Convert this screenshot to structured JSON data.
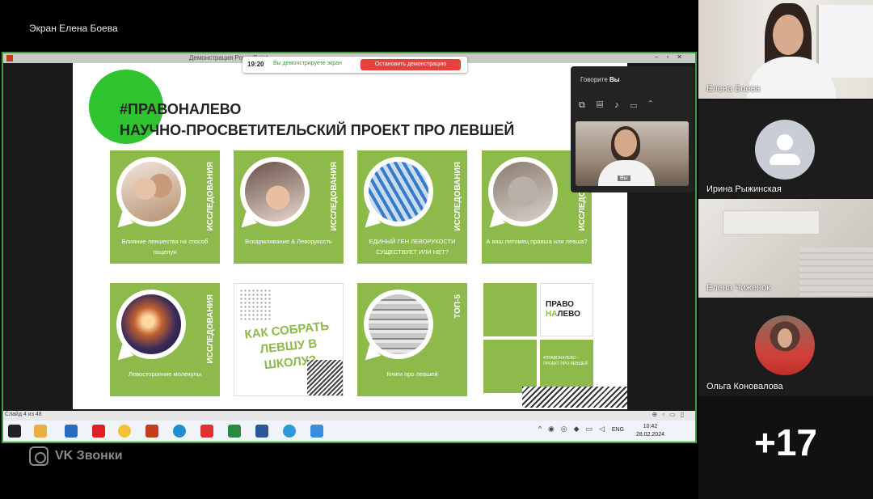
{
  "screen_label": "Экран Елена Боева",
  "demo_bar": {
    "time": "19:20",
    "message": "Вы демонстрируете экран",
    "stop_button": "Остановить демонстрацию"
  },
  "ppt": {
    "title": "Демонстрация PowerPoint",
    "status": "Слайд 4 из 48"
  },
  "slide": {
    "title_line1": "#ПРАВОНАЛЕВО",
    "title_line2": "НАУЧНО-ПРОСВЕТИТЕЛЬСКИЙ ПРОЕКТ ПРО ЛЕВШЕЙ",
    "tiles": [
      {
        "vertical": "ИССЛЕДОВАНИЯ",
        "caption": "Влияние левшества на способ поцелуя"
      },
      {
        "vertical": "ИССЛЕДОВАНИЯ",
        "caption": "Вскармливание & Леворукость"
      },
      {
        "vertical": "ИССЛЕДОВАНИЯ",
        "caption": "ЕДИНЫЙ ГЕН ЛЕВОРУКОСТИ СУЩЕСТВУЕТ ИЛИ НЕТ?"
      },
      {
        "vertical": "ИССЛЕДОВАНИЯ",
        "caption": "А ваш питомец правша или левша?"
      },
      {
        "vertical": "ИССЛЕДОВАНИЯ",
        "caption": "Левосторонние молекулы"
      },
      {
        "big": "КАК СОБРАТЬ ЛЕВШУ В ШКОЛУ?"
      },
      {
        "vertical": "ТОП-5",
        "caption": "Книги про левшей"
      }
    ],
    "logo_prefix": "ПРАВО",
    "logo_mid": "НА",
    "logo_suffix": "ЛЕВО",
    "hashtag_block": "#ПРАВОНАЛЕВО – ПРОЕКТ ПРО ЛЕВШЕЙ"
  },
  "taskbar": {
    "lang": "ENG",
    "time": "10:42",
    "date": "28.02.2024"
  },
  "self_view": {
    "speaking_label": "Говорите",
    "speaking_name": "Вы",
    "you_label": "Вы"
  },
  "participants": [
    {
      "name": "Елена Боева"
    },
    {
      "name": "Ирина Рыжинская"
    },
    {
      "name": "Елена Чиженок"
    },
    {
      "name": "Ольга Коновалова"
    }
  ],
  "more_count": "+17",
  "brand": "VK Звонки",
  "colors": {
    "accent_green": "#8dba4a",
    "stop_red": "#e8413c",
    "frame_green": "#3ca03c"
  }
}
